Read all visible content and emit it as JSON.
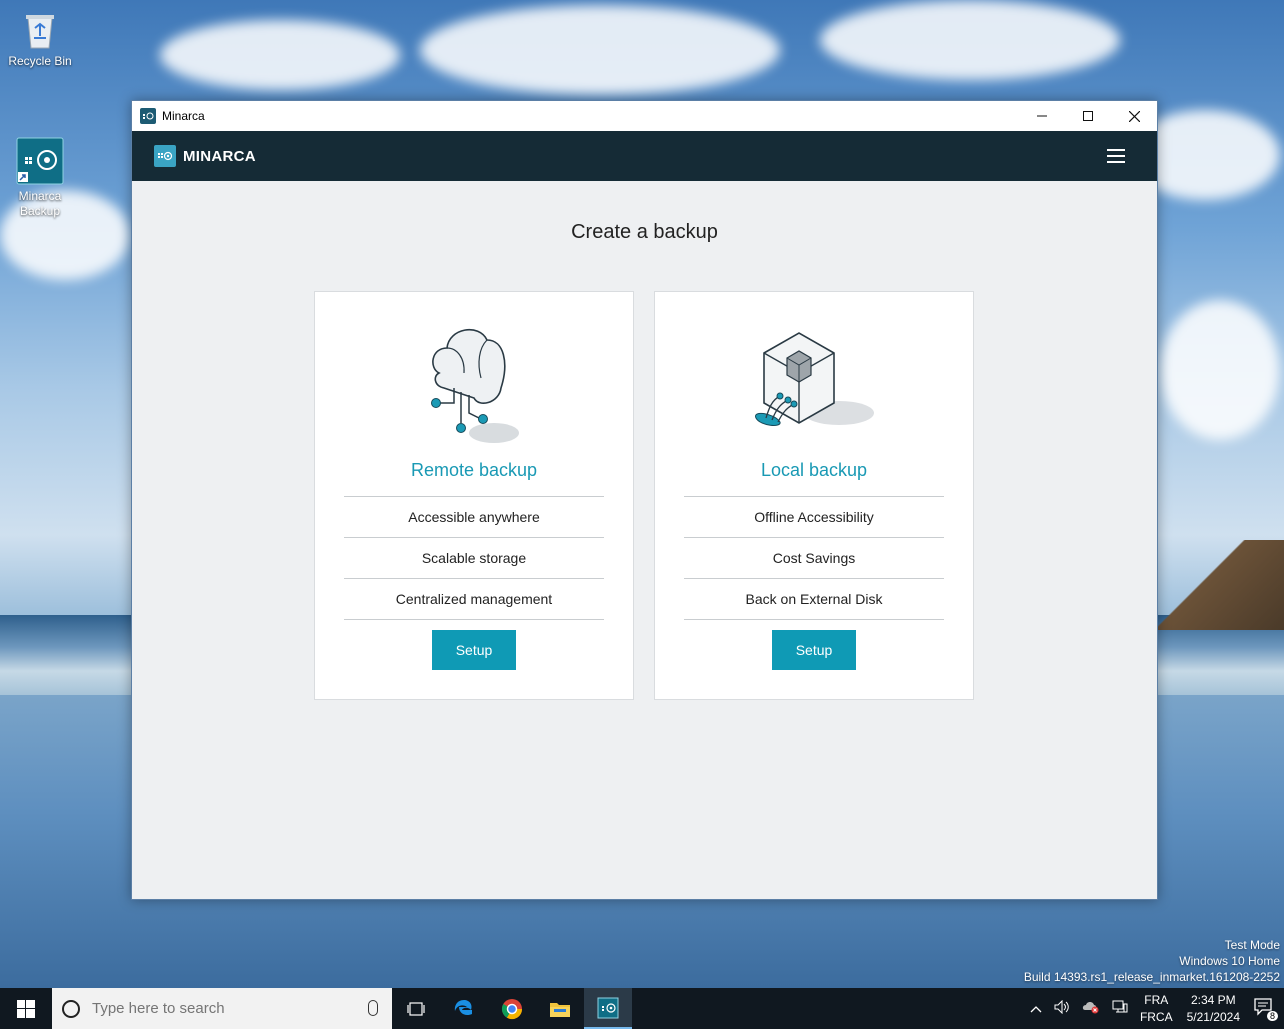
{
  "desktop": {
    "icons": [
      {
        "label": "Recycle Bin"
      },
      {
        "label": "Minarca\nBackup"
      }
    ],
    "watermark": [
      "Test Mode",
      "Windows 10 Home",
      "Build 14393.rs1_release_inmarket.161208-2252"
    ]
  },
  "window": {
    "title": "Minarca",
    "controls": {
      "minimize": "—",
      "maximize": "☐",
      "close": "✕"
    }
  },
  "app": {
    "brand": "MINARCA",
    "heading": "Create a backup",
    "cards": [
      {
        "title": "Remote backup",
        "features": [
          "Accessible anywhere",
          "Scalable storage",
          "Centralized management"
        ],
        "button": "Setup"
      },
      {
        "title": "Local backup",
        "features": [
          "Offline Accessibility",
          "Cost Savings",
          "Back on External Disk"
        ],
        "button": "Setup"
      }
    ],
    "colors": {
      "accent": "#1999b4",
      "button": "#0f9ab5",
      "header": "#152b36"
    }
  },
  "taskbar": {
    "search_placeholder": "Type here to search",
    "language_top": "FRA",
    "language_bottom": "FRCA",
    "time": "2:34 PM",
    "date": "5/21/2024",
    "notification_count": "8"
  }
}
